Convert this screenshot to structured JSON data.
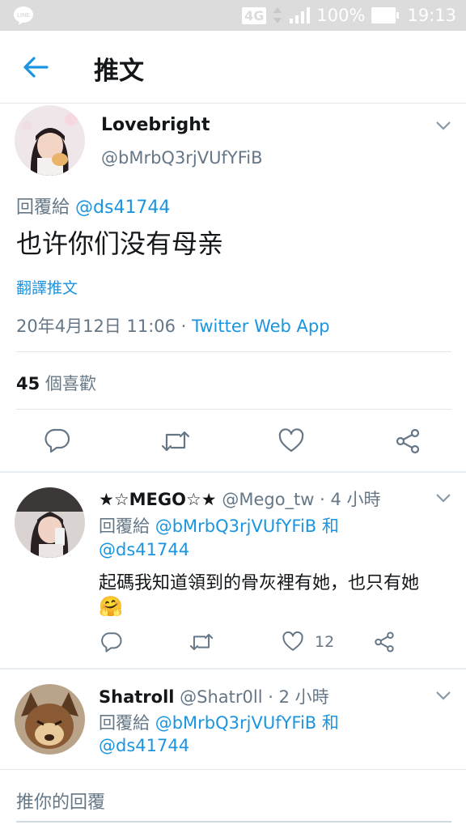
{
  "status_bar": {
    "app_icon": "line-icon",
    "network": "4G",
    "battery": "100%",
    "time": "19:13"
  },
  "header": {
    "back_icon": "arrow-left-icon",
    "title": "推文"
  },
  "main_tweet": {
    "display_name": "Lovebright",
    "handle": "@bMrbQ3rjVUfYFiB",
    "reply_prefix": "回覆給",
    "reply_to": "@ds41744",
    "text": "也许你们没有母亲",
    "translate_label": "翻譯推文",
    "timestamp": "20年4月12日 11:06 · ",
    "source": "Twitter Web App",
    "likes_count": "45",
    "likes_label": "個喜歡",
    "actions": [
      "reply-icon",
      "retweet-icon",
      "like-icon",
      "share-icon"
    ]
  },
  "replies": [
    {
      "display_name": "★☆MEGO☆★",
      "handle": "@Mego_tw",
      "time": "· 4 小時",
      "reply_prefix": "回覆給",
      "reply_to_1": "@bMrbQ3rjVUfYFiB",
      "reply_and": "和",
      "reply_to_2": "@ds41744",
      "text": "起碼我知道領到的骨灰裡有她，也只有她",
      "emoji": "🤗",
      "like_count": "12"
    },
    {
      "display_name": "Shatroll",
      "handle": "@Shatr0ll",
      "time": "· 2 小時",
      "reply_prefix": "回覆給",
      "reply_to_1": "@bMrbQ3rjVUfYFiB",
      "reply_and": "和",
      "reply_to_2": "@ds41744"
    }
  ],
  "compose": {
    "placeholder": "推你的回覆"
  },
  "colors": {
    "accent": "#1b95e0",
    "text": "#14171a",
    "muted": "#657786",
    "divider": "#e1e8ed",
    "status_bar": "#dcdcdc"
  }
}
